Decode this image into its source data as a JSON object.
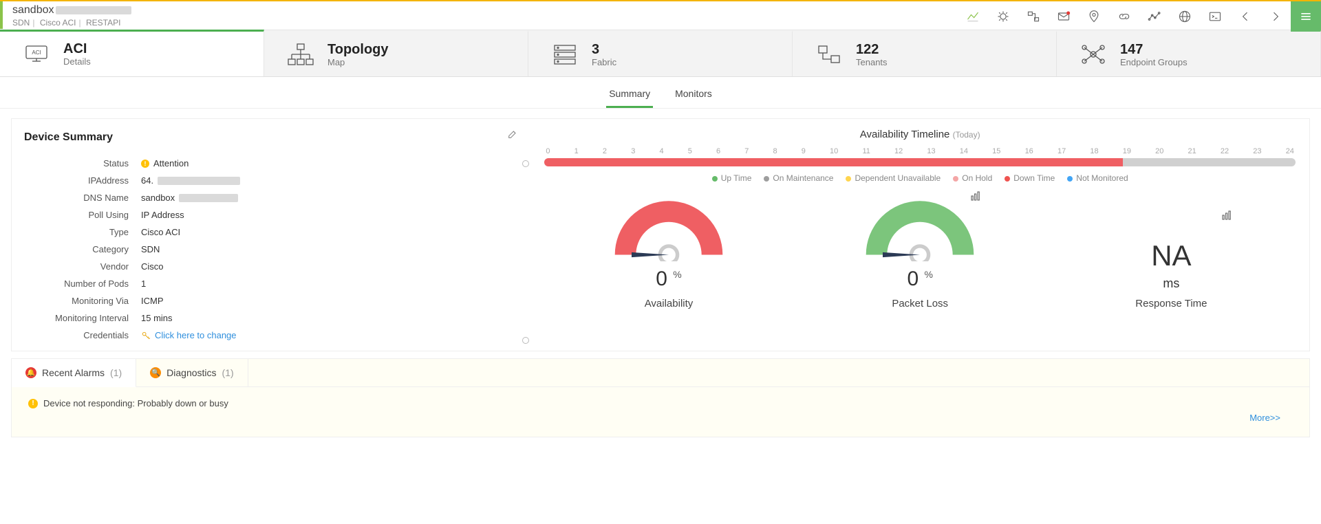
{
  "header": {
    "title_prefix": "sandbox",
    "breadcrumbs": [
      "SDN",
      "Cisco ACI",
      "RESTAPI"
    ]
  },
  "sections": [
    {
      "big": "ACI",
      "sub": "Details",
      "icon": "aci",
      "active": true
    },
    {
      "big": "Topology",
      "sub": "Map",
      "icon": "topology",
      "active": false
    },
    {
      "big": "3",
      "sub": "Fabric",
      "icon": "fabric",
      "active": false
    },
    {
      "big": "122",
      "sub": "Tenants",
      "icon": "tenants",
      "active": false
    },
    {
      "big": "147",
      "sub": "Endpoint Groups",
      "icon": "endpoints",
      "active": false
    }
  ],
  "subtabs": {
    "summary": "Summary",
    "monitors": "Monitors",
    "active": "summary"
  },
  "device_summary": {
    "heading": "Device Summary",
    "status_label": "Status",
    "status_value": "Attention",
    "ip_label": "IPAddress",
    "ip_value_prefix": "64.",
    "dns_label": "DNS Name",
    "dns_value_prefix": "sandbox",
    "poll_label": "Poll Using",
    "poll_value": "IP Address",
    "type_label": "Type",
    "type_value": "Cisco ACI",
    "category_label": "Category",
    "category_value": "SDN",
    "vendor_label": "Vendor",
    "vendor_value": "Cisco",
    "pods_label": "Number of Pods",
    "pods_value": "1",
    "monvia_label": "Monitoring Via",
    "monvia_value": "ICMP",
    "interval_label": "Monitoring Interval",
    "interval_value": "15 mins",
    "cred_label": "Credentials",
    "cred_link": "Click here to change"
  },
  "timeline": {
    "title": "Availability Timeline",
    "period": "(Today)",
    "hours": [
      "0",
      "1",
      "2",
      "3",
      "4",
      "5",
      "6",
      "7",
      "8",
      "9",
      "10",
      "11",
      "12",
      "13",
      "14",
      "15",
      "16",
      "17",
      "18",
      "19",
      "20",
      "21",
      "22",
      "23",
      "24"
    ],
    "legend": {
      "up": "Up Time",
      "maint": "On Maintenance",
      "dep": "Dependent Unavailable",
      "hold": "On Hold",
      "down": "Down Time",
      "nom": "Not Monitored"
    }
  },
  "gauges": {
    "availability": {
      "value": "0",
      "unit": "%",
      "label": "Availability",
      "color": "#ef5f63"
    },
    "packet_loss": {
      "value": "0",
      "unit": "%",
      "label": "Packet Loss",
      "color": "#7cc57c"
    },
    "response_time": {
      "value": "NA",
      "unit": "ms",
      "label": "Response Time"
    }
  },
  "bottom": {
    "tab1": "Recent Alarms",
    "tab1_count": "(1)",
    "tab2": "Diagnostics",
    "tab2_count": "(1)",
    "alarm_text": "Device not responding: Probably down or busy",
    "more": "More>>"
  },
  "chart_data": {
    "type": "bar",
    "title": "Availability Timeline (Today)",
    "x": [
      0,
      1,
      2,
      3,
      4,
      5,
      6,
      7,
      8,
      9,
      10,
      11,
      12,
      13,
      14,
      15,
      16,
      17,
      18,
      19,
      20,
      21,
      22,
      23,
      24
    ],
    "series": [
      {
        "name": "Down Time",
        "range": [
          0,
          18.5
        ]
      },
      {
        "name": "Not Monitored",
        "range": [
          18.5,
          24
        ]
      }
    ],
    "gauges": {
      "availability_percent": 0,
      "packet_loss_percent": 0,
      "response_time_ms": null
    }
  }
}
